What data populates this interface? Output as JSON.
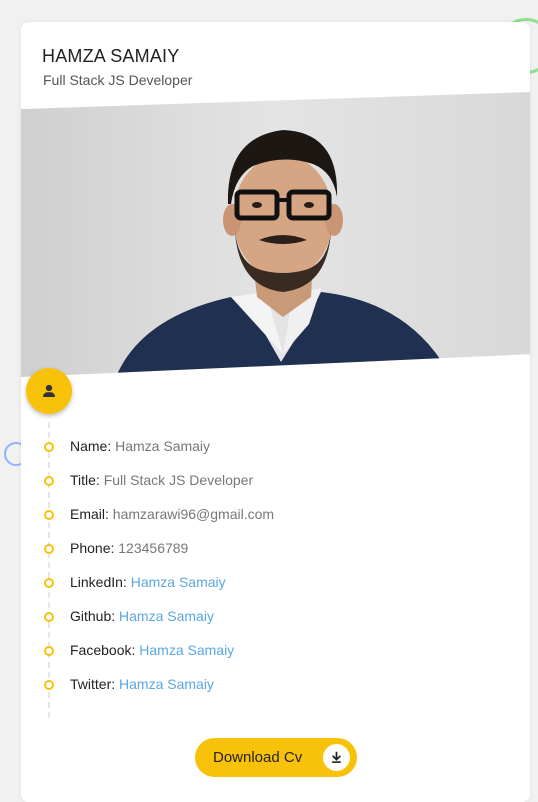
{
  "profile": {
    "name": "HAMZA SAMAIY",
    "title": "Full Stack JS Developer"
  },
  "icons": {
    "avatar": "person-icon",
    "download": "download-icon"
  },
  "colors": {
    "accent": "#f9c20a",
    "link": "#5aa7e0",
    "label": "#222222",
    "value": "#777777"
  },
  "info": {
    "name": {
      "label": "Name:",
      "value": "Hamza Samaiy"
    },
    "title": {
      "label": "Title:",
      "value": "Full Stack JS Developer"
    },
    "email": {
      "label": "Email:",
      "value": "hamzarawi96@gmail.com"
    },
    "phone": {
      "label": "Phone:",
      "value": "123456789"
    },
    "linkedin": {
      "label": "LinkedIn:",
      "value": "Hamza Samaiy"
    },
    "github": {
      "label": "Github:",
      "value": "Hamza Samaiy"
    },
    "facebook": {
      "label": "Facebook:",
      "value": "Hamza Samaiy"
    },
    "twitter": {
      "label": "Twitter:",
      "value": "Hamza Samaiy"
    }
  },
  "actions": {
    "download_label": "Download Cv"
  }
}
